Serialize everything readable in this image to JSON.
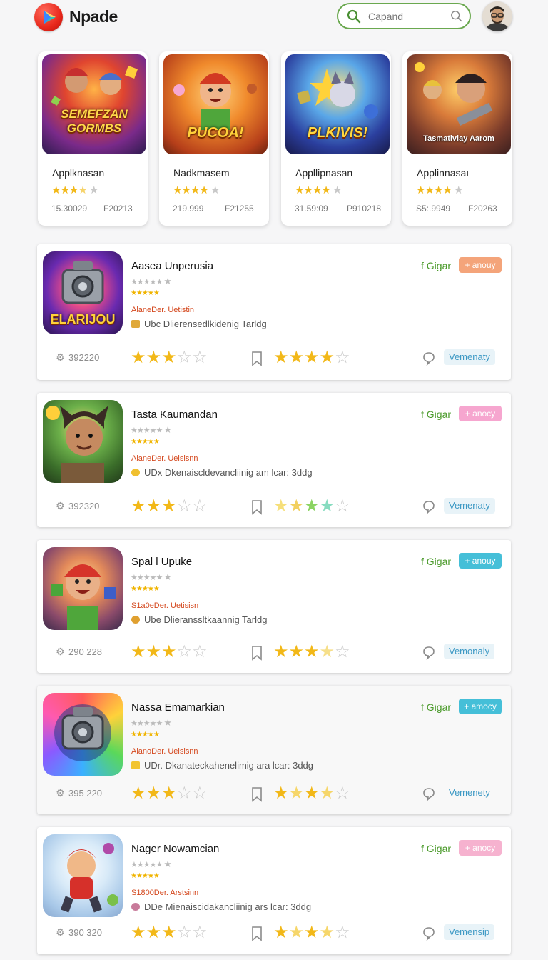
{
  "header": {
    "brand": "Npade",
    "search_placeholder": "Capand",
    "logo_icon": "play-logo-icon",
    "search_icon": "search-icon",
    "avatar_icon": "user-avatar"
  },
  "featured": [
    {
      "art_text": "SEMEFZAN GORMBS",
      "name": "Applknasan",
      "rating": 3.5,
      "stat1": "15.30029",
      "stat2": "F20213"
    },
    {
      "art_text": "PUCOA!",
      "name": "Nadkmasem",
      "rating": 4,
      "stat1": "219.999",
      "stat2": "F21255"
    },
    {
      "art_text": "PLKIVIS!",
      "name": "Appllipnasan",
      "rating": 4,
      "stat1": "31.59:09",
      "stat2": "P910218"
    },
    {
      "art_text": "Tasmatlviay Aarom",
      "name": "Applinnasaı",
      "rating": 4,
      "stat1": "S5:.9949",
      "stat2": "F20263"
    }
  ],
  "rows": [
    {
      "title": "Aasea Unperusia",
      "developer": "AlaneDer. Uetistin",
      "description": "Ubc Dlierensedlkidenig Tarldg",
      "share": "f Gigar",
      "badge": "+ anouy",
      "badge_color": "#f4a47a",
      "count": "392220",
      "rating_primary": 3,
      "rating_secondary": 5,
      "pill": "Vemenaty",
      "art_text": "ELARIJOU"
    },
    {
      "title": "Tasta Kaumandan",
      "developer": "AlaneDer. Ueisisnn",
      "description": "UDx Dkenaiscldevancliinig am lcar: 3ddg",
      "share": "f Gigar",
      "badge": "+ anocy",
      "badge_color": "#f6a6cf",
      "count": "392320",
      "rating_primary": 3,
      "rating_secondary": 4,
      "pill": "Vemenaty",
      "art_text": ""
    },
    {
      "title": "Spal l Upuke",
      "developer": "S1a0eDer. Uetisisn",
      "description": "Ube Dlieranssltkaannig Tarldg",
      "share": "f Gigar",
      "badge": "+ anouy",
      "badge_color": "#45bfd8",
      "count": "290 228",
      "rating_primary": 3,
      "rating_secondary": 3.5,
      "pill": "Vemonaly",
      "art_text": ""
    },
    {
      "title": "Nassa Emamarkian",
      "developer": "AlanoDer. Ueisisnn",
      "description": "UDr. Dkanateckahenelimig ara lcar: 3ddg",
      "share": "f Gigar",
      "badge": "+ amocy",
      "badge_color": "#45bfd8",
      "count": "395 220",
      "rating_primary": 3,
      "rating_secondary": 4,
      "pill": "Vemenety",
      "art_text": ""
    },
    {
      "title": "Nager Nowamcian",
      "developer": "S1800Der. Arstsinn",
      "description": "DDe Mienaiscidakancliinig ars lcar: 3ddg",
      "share": "f Gigar",
      "badge": "+ anocy",
      "badge_color": "#f6b2cf",
      "count": "390 320",
      "rating_primary": 3,
      "rating_secondary": 4,
      "pill": "Vemensip",
      "art_text": ""
    }
  ]
}
